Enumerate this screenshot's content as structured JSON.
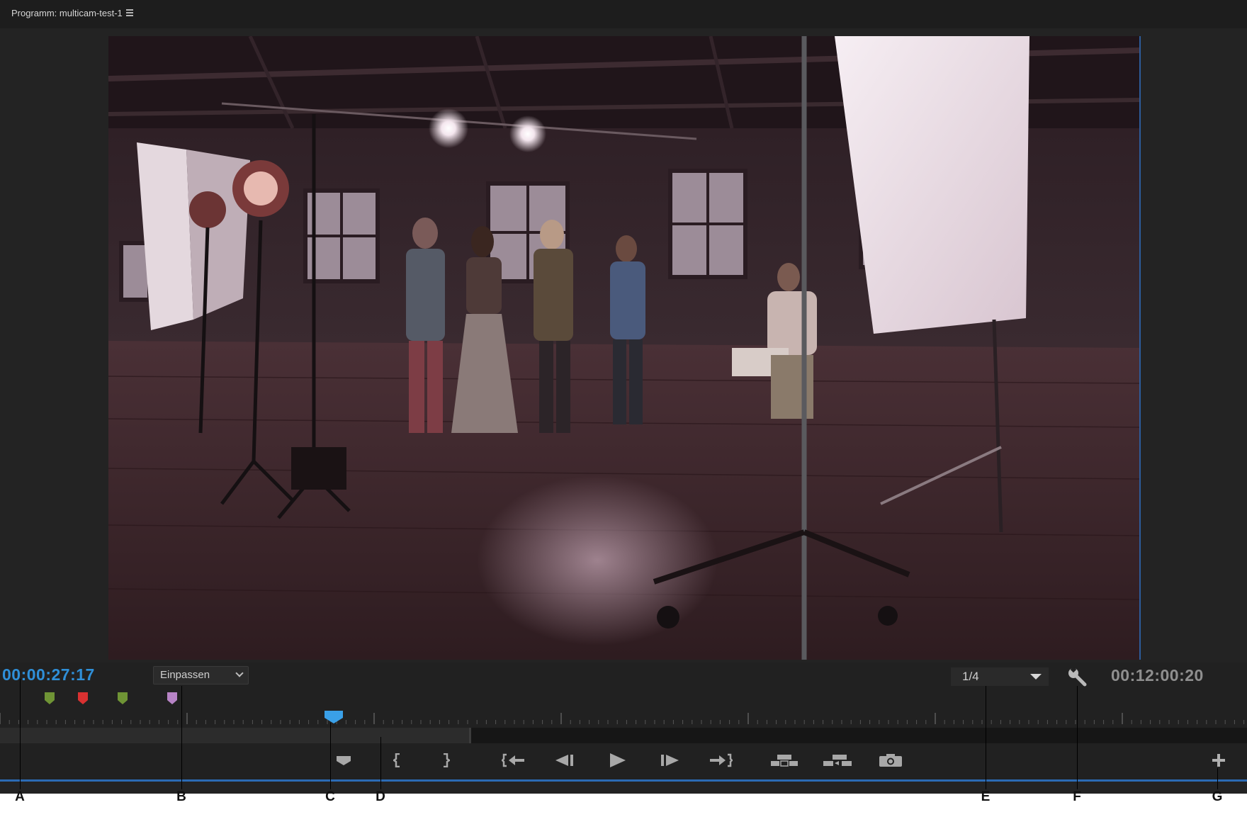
{
  "panel": {
    "title": "Programm: multicam-test-1",
    "menu_icon": "hamburger-icon"
  },
  "monitor": {
    "timecode_current": "00:00:27:17",
    "zoom_value": "Einpassen",
    "resolution_value": "1/4",
    "timecode_duration": "00:12:00:20",
    "settings_icon": "wrench-icon"
  },
  "markers": [
    {
      "name": "marker-green-1",
      "color": "#6f9435"
    },
    {
      "name": "marker-red",
      "color": "#d93131"
    },
    {
      "name": "marker-green-2",
      "color": "#6f9435"
    },
    {
      "name": "marker-violet",
      "color": "#b784c6"
    }
  ],
  "transport": [
    {
      "name": "add-marker-button",
      "icon": "marker-icon"
    },
    {
      "name": "mark-in-button",
      "icon": "mark-in-icon"
    },
    {
      "name": "mark-out-button",
      "icon": "mark-out-icon"
    },
    {
      "name": "go-to-in-button",
      "icon": "go-to-in-icon"
    },
    {
      "name": "step-back-button",
      "icon": "step-back-icon"
    },
    {
      "name": "play-button",
      "icon": "play-icon"
    },
    {
      "name": "step-forward-button",
      "icon": "step-forward-icon"
    },
    {
      "name": "go-to-out-button",
      "icon": "go-to-out-icon"
    },
    {
      "name": "lift-button",
      "icon": "lift-icon"
    },
    {
      "name": "extract-button",
      "icon": "extract-icon"
    },
    {
      "name": "export-frame-button",
      "icon": "camera-icon"
    },
    {
      "name": "button-editor-button",
      "icon": "plus-icon"
    }
  ],
  "callouts": [
    "A",
    "B",
    "C",
    "D",
    "E",
    "F",
    "G"
  ],
  "colors": {
    "timecode_current": "#2f8fd8",
    "timecode_duration": "#8f8f8f",
    "playhead": "#3aa0e8",
    "accent_line": "#2b6bb4"
  }
}
